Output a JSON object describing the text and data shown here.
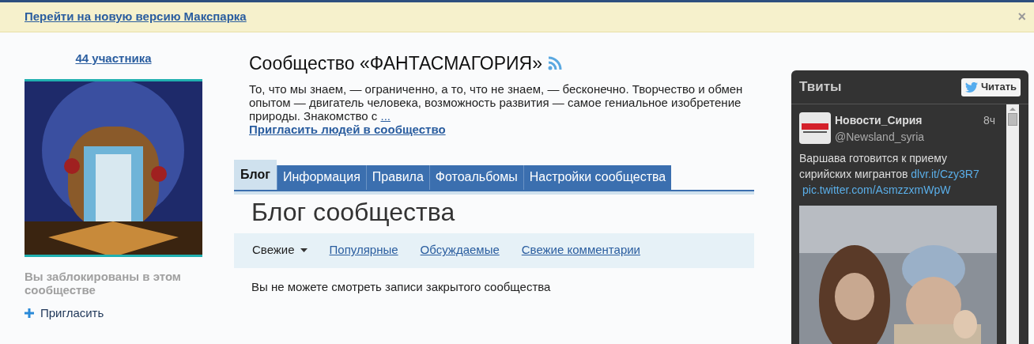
{
  "banner": {
    "link": "Перейти на новую версию Макспарка",
    "close": "×"
  },
  "sidebar": {
    "members": "44 участника",
    "blocked_note": "Вы заблокированы в этом сообществе",
    "invite": "Пригласить"
  },
  "community": {
    "title": "Сообщество «ФАНТАСМАГОРИЯ»",
    "description": "То, что мы знаем, — ограниченно, а то, что не знаем, — бесконечно. Творчество и обмен опытом — двигатель человека, возможность развития — самое гениальное изобретение природы. Знакомство с",
    "more": "...",
    "invite_link": "Пригласить людей в сообщество"
  },
  "tabs": [
    {
      "label": "Блог",
      "selected": true
    },
    {
      "label": "Информация",
      "selected": false
    },
    {
      "label": "Правила",
      "selected": false
    },
    {
      "label": "Фотоальбомы",
      "selected": false
    },
    {
      "label": "Настройки сообщества",
      "selected": false
    }
  ],
  "blog": {
    "heading": "Блог сообщества",
    "filters": [
      {
        "label": "Свежие",
        "selected": true
      },
      {
        "label": "Популярные",
        "selected": false
      },
      {
        "label": "Обсуждаемые",
        "selected": false
      },
      {
        "label": "Свежие комментарии",
        "selected": false
      }
    ],
    "message": "Вы не можете смотреть записи закрытого сообщества"
  },
  "tweets": {
    "title": "Твиты",
    "follow_button": "Читать",
    "items": [
      {
        "name": "Новости_Сирия",
        "handle": "@Newsland_syria",
        "time": "8ч",
        "text": "Варшава готовится к приему сирийских мигрантов",
        "links": [
          "dlvr.it/Czy3R7",
          "pic.twitter.com/AsmzzxmWpW"
        ]
      }
    ]
  }
}
